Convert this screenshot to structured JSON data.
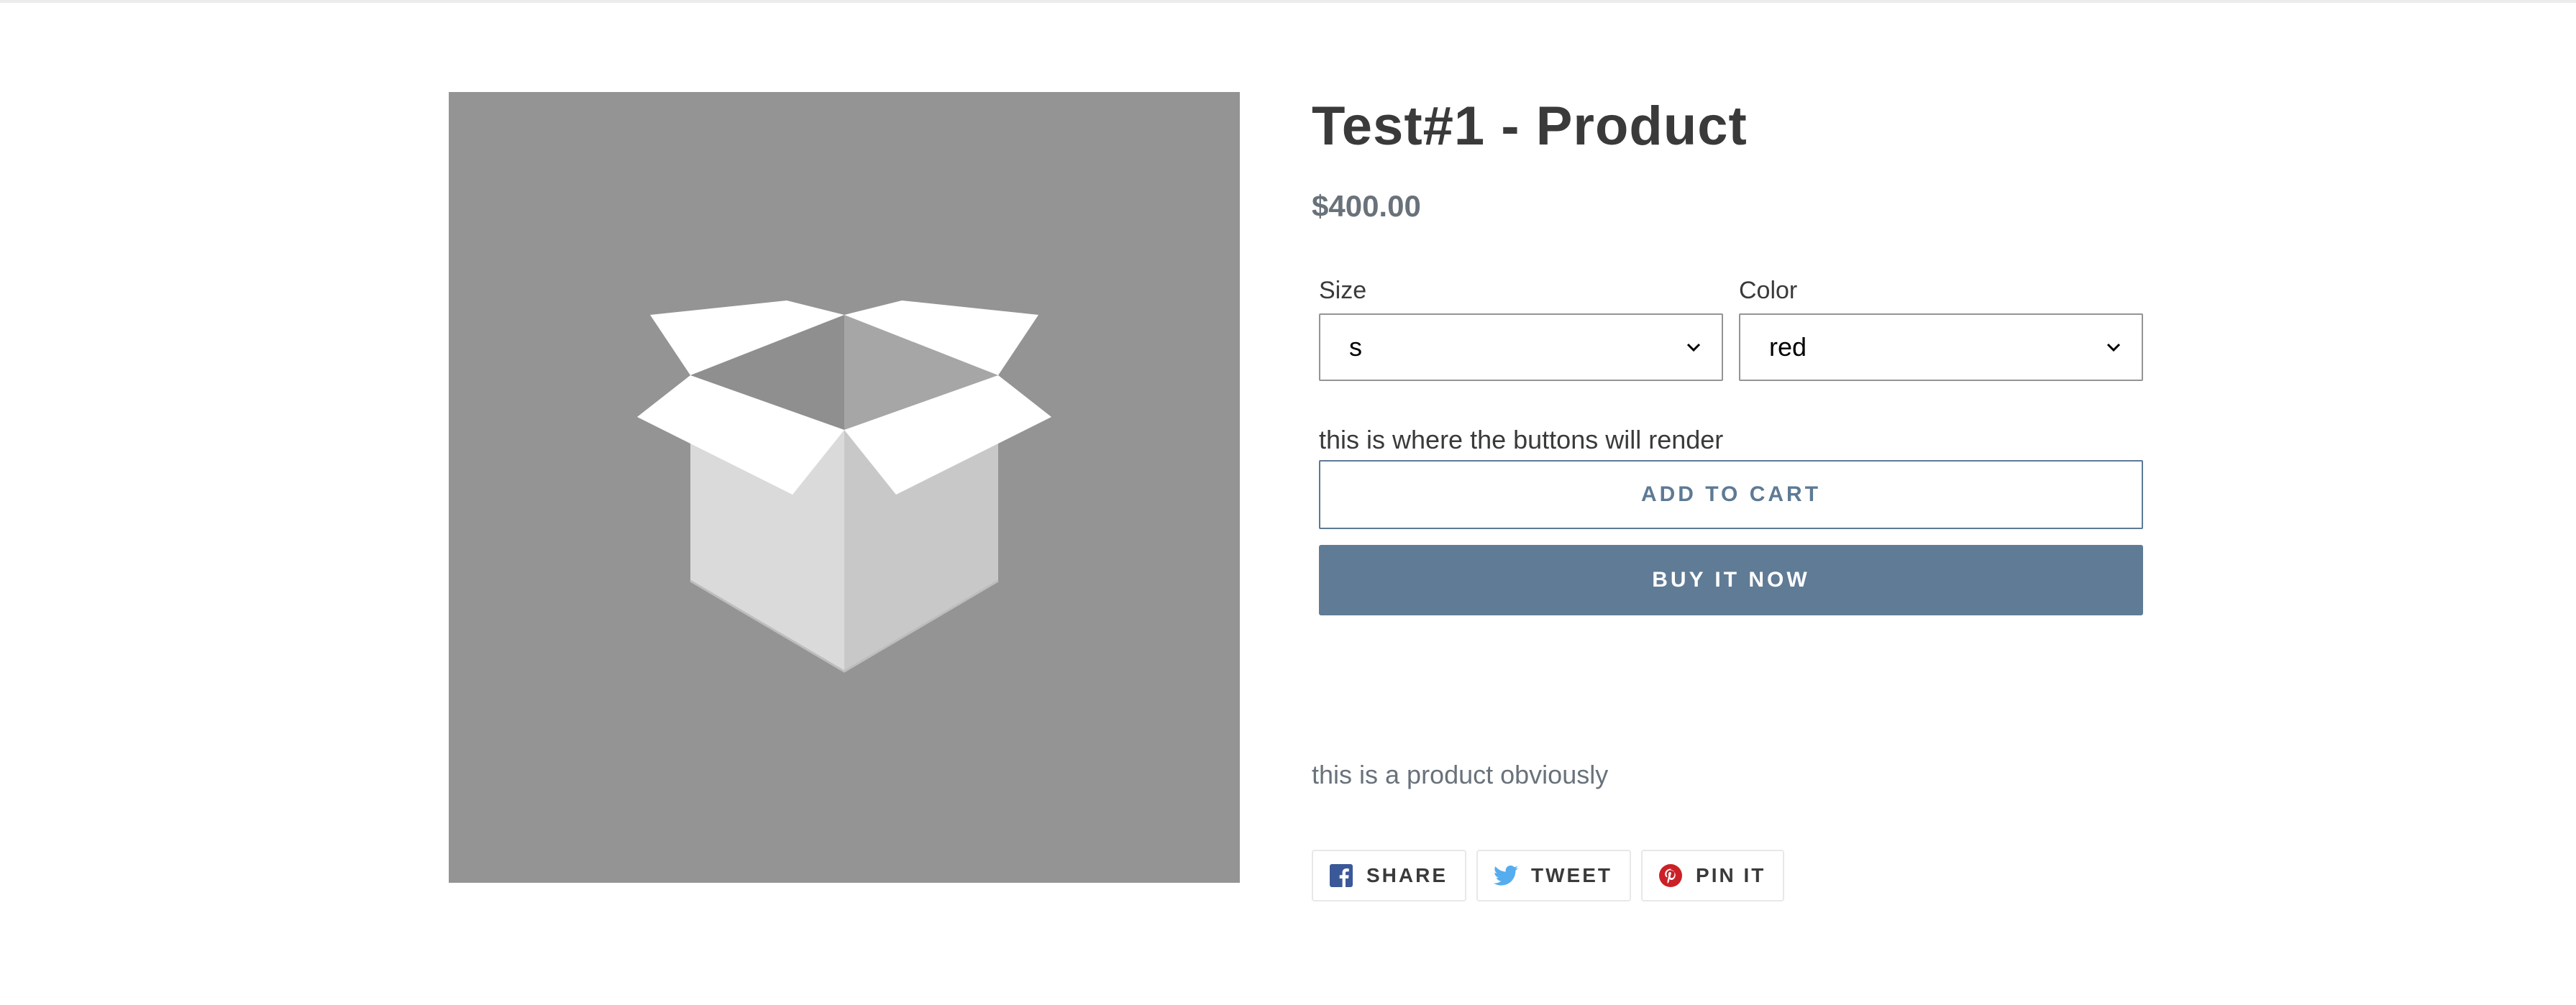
{
  "product": {
    "title": "Test#1 - Product",
    "price": "$400.00",
    "image_icon": "open-box-placeholder-icon",
    "description": "this is a product obviously"
  },
  "options": {
    "size": {
      "label": "Size",
      "value": "s"
    },
    "color": {
      "label": "Color",
      "value": "red"
    }
  },
  "buttons": {
    "note": "this is where the buttons will render",
    "add_to_cart": "ADD TO CART",
    "buy_now": "BUY IT NOW"
  },
  "share": {
    "facebook": {
      "label": "SHARE",
      "icon": "facebook-icon"
    },
    "twitter": {
      "label": "TWEET",
      "icon": "twitter-icon"
    },
    "pinterest": {
      "label": "PIN IT",
      "icon": "pinterest-icon"
    }
  },
  "colors": {
    "accent": "#5f7b95",
    "text_dark": "#3a3a3a",
    "text_muted": "#69727b",
    "image_bg": "#949494",
    "facebook": "#3b5998",
    "twitter": "#55acee",
    "pinterest": "#cb2027"
  }
}
